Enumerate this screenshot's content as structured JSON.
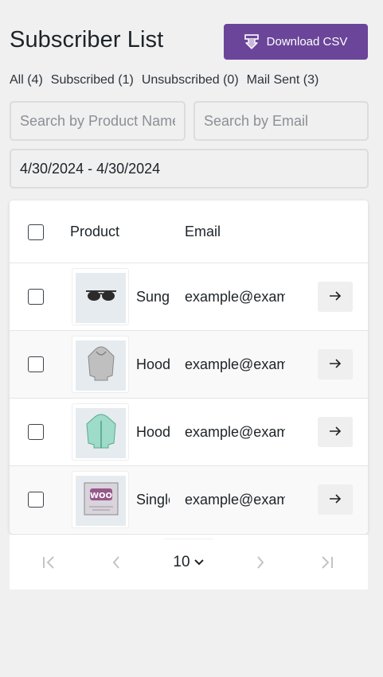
{
  "header": {
    "title": "Subscriber List",
    "download_label": "Download CSV",
    "accent_color": "#6b4599"
  },
  "filters": [
    {
      "label": "All (4)"
    },
    {
      "label": "Subscribed (1)"
    },
    {
      "label": "Unsubscribed (0)"
    },
    {
      "label": "Mail Sent (3)"
    }
  ],
  "search": {
    "product_placeholder": "Search by Product Name",
    "email_placeholder": "Search by Email",
    "date_value": "4/30/2024 - 4/30/2024"
  },
  "table": {
    "columns": [
      "Product",
      "Email"
    ],
    "rows": [
      {
        "product": "Sunglasses",
        "email": "example@example.com",
        "icon": "sunglasses-icon"
      },
      {
        "product": "Hoodie",
        "email": "example@example.com",
        "icon": "hoodie-icon"
      },
      {
        "product": "Hoodie with Zipper",
        "email": "example@example.com",
        "icon": "hoodie-zipper-icon"
      },
      {
        "product": "Single",
        "email": "example@example.com",
        "icon": "woo-album-icon"
      }
    ]
  },
  "pagination": {
    "per_page": "10"
  }
}
